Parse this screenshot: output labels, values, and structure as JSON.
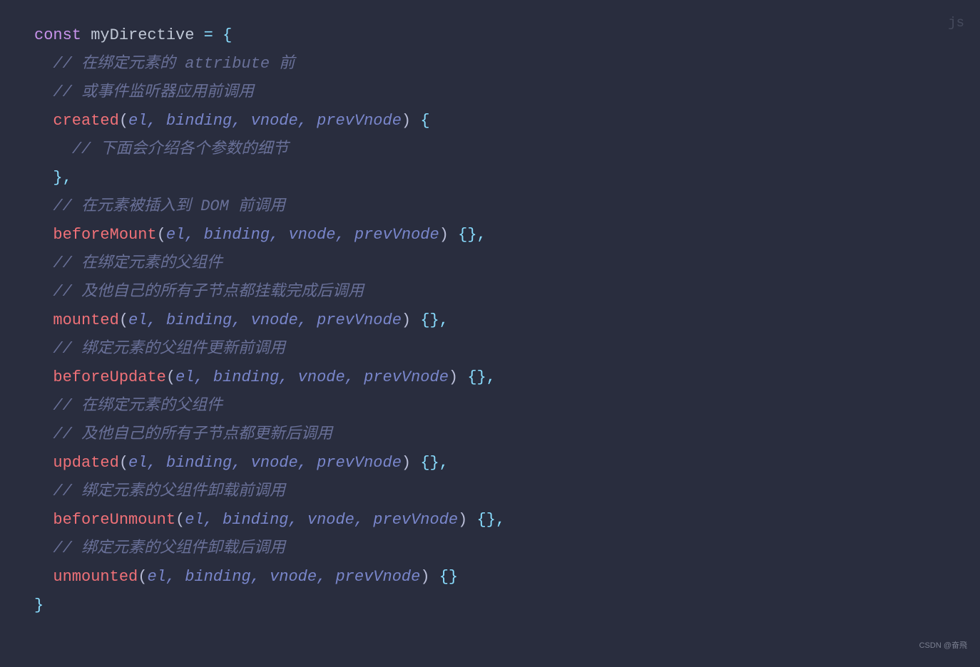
{
  "langLabel": "js",
  "watermark": "CSDN @奋飛",
  "code": {
    "kw_const": "const",
    "varName": "myDirective",
    "eq": "=",
    "open": "{",
    "close": "}",
    "comma": ",",
    "openParen": "(",
    "closeParen": ")",
    "bracePair": "{}",
    "c1": "// 在绑定元素的 attribute 前",
    "c2": "// 或事件监听器应用前调用",
    "fn_created": "created",
    "params": "el, binding, vnode, prevVnode",
    "c3": "// 下面会介绍各个参数的细节",
    "c4": "// 在元素被插入到 DOM 前调用",
    "fn_beforeMount": "beforeMount",
    "c5": "// 在绑定元素的父组件",
    "c6": "// 及他自己的所有子节点都挂载完成后调用",
    "fn_mounted": "mounted",
    "c7": "// 绑定元素的父组件更新前调用",
    "fn_beforeUpdate": "beforeUpdate",
    "c8": "// 在绑定元素的父组件",
    "c9": "// 及他自己的所有子节点都更新后调用",
    "fn_updated": "updated",
    "c10": "// 绑定元素的父组件卸载前调用",
    "fn_beforeUnmount": "beforeUnmount",
    "c11": "// 绑定元素的父组件卸载后调用",
    "fn_unmounted": "unmounted"
  }
}
